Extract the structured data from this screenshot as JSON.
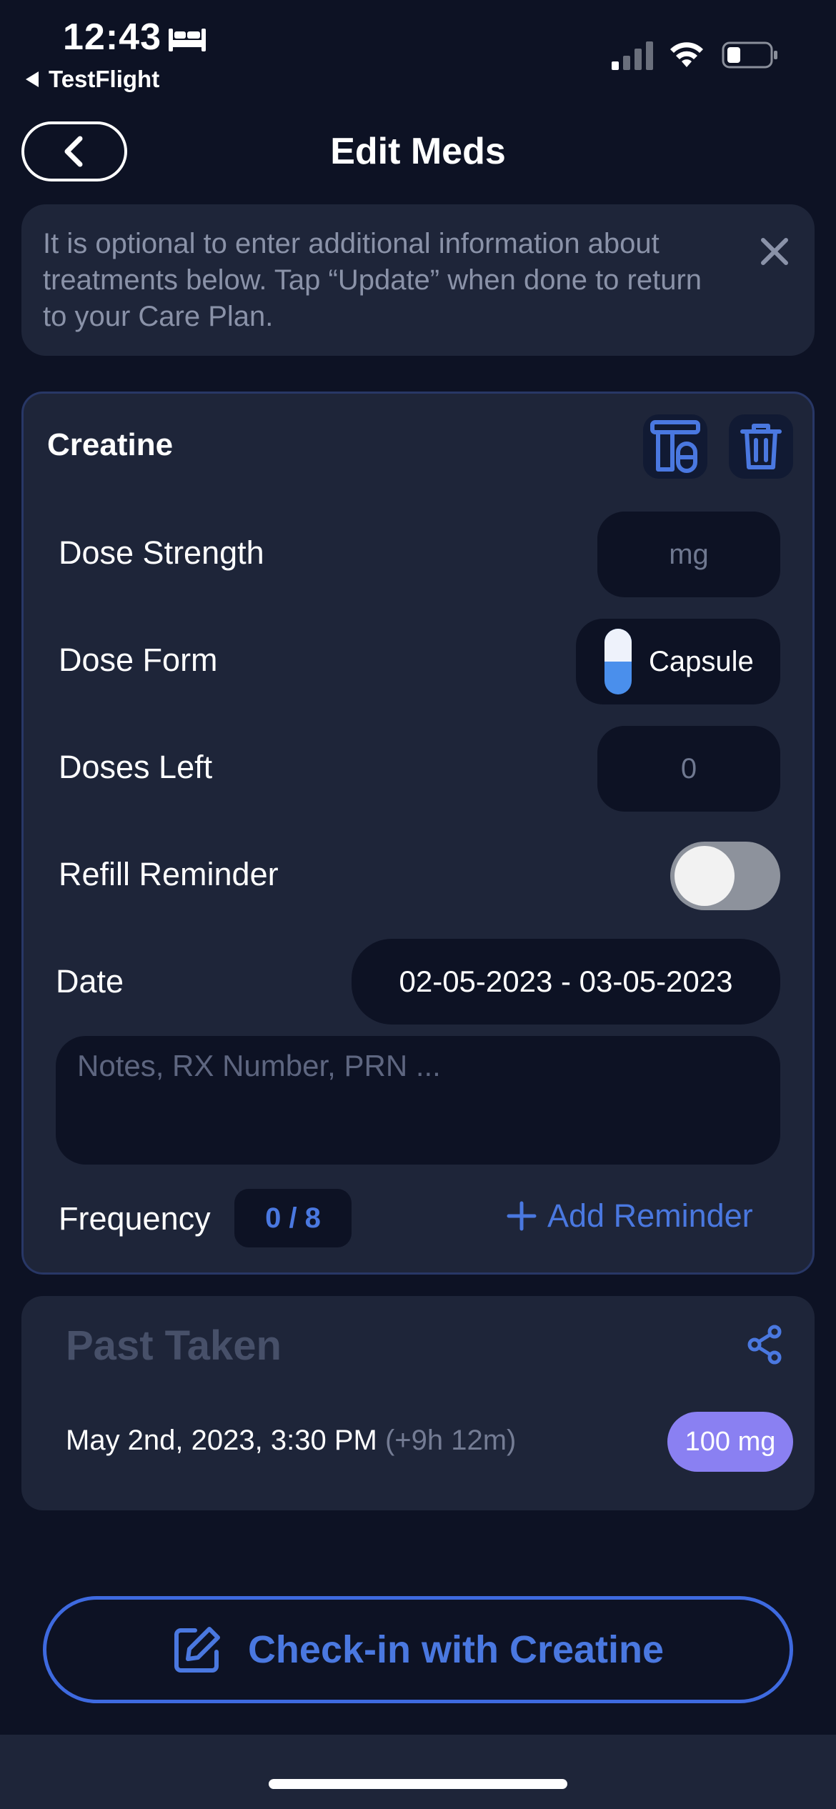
{
  "status_bar": {
    "time": "12:43",
    "back_app": "TestFlight"
  },
  "header": {
    "title": "Edit Meds"
  },
  "banner": {
    "text": "It is optional to enter additional information about treatments below. Tap “Update” when done to return to your Care Plan."
  },
  "medication": {
    "name": "Creatine",
    "rows": {
      "dose_strength_label": "Dose Strength",
      "dose_strength_placeholder": "mg",
      "dose_form_label": "Dose Form",
      "dose_form_value": "Capsule",
      "doses_left_label": "Doses Left",
      "doses_left_placeholder": "0",
      "refill_label": "Refill Reminder",
      "refill_enabled": false,
      "date_label": "Date",
      "date_value": "02-05-2023 - 03-05-2023",
      "notes_placeholder": "Notes, RX Number, PRN ...",
      "frequency_label": "Frequency",
      "frequency_value": "0 / 8",
      "add_reminder": "Add Reminder"
    }
  },
  "past_taken": {
    "title": "Past Taken",
    "entries": [
      {
        "datetime": "May 2nd, 2023, 3:30 PM",
        "relative": "(+9h 12m)",
        "dose": "100 mg"
      }
    ]
  },
  "checkin": {
    "label": "Check-in with Creatine"
  },
  "colors": {
    "background": "#0d1224",
    "card": "#1e2539",
    "accent": "#4a78e0",
    "dose_badge": "#8a80f2"
  }
}
